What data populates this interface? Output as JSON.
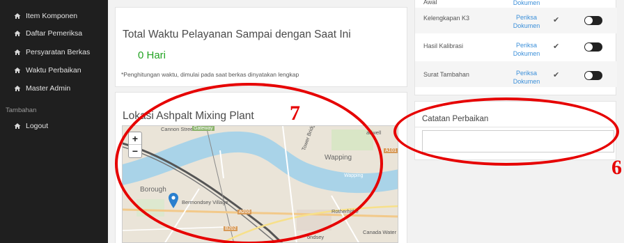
{
  "sidebar": {
    "items": [
      {
        "label": "Item Komponen",
        "icon": "home-icon"
      },
      {
        "label": "Daftar Pemeriksa",
        "icon": "home-icon"
      },
      {
        "label": "Persyaratan Berkas",
        "icon": "home-icon"
      },
      {
        "label": "Waktu Perbaikan",
        "icon": "home-icon"
      },
      {
        "label": "Master Admin",
        "icon": "home-icon"
      }
    ],
    "section_label": "Tambahan",
    "logout_label": "Logout"
  },
  "total_time": {
    "title": "Total Waktu Pelayanan Sampai dengan Saat Ini",
    "value": "0 Hari",
    "note": "*Penghitungan waktu, dimulai pada saat berkas dinyatakan lengkap"
  },
  "map_card": {
    "title": "Lokasi Ashpalt Mixing Plant",
    "zoom_in": "+",
    "zoom_out": "−",
    "labels": {
      "cannon_street": "Cannon Street",
      "gateway": "Gateway",
      "tower_bridge": "Tower Bridge",
      "wapping": "Wapping",
      "wapping_road": "Wapping",
      "borough": "Borough",
      "bermondsey_village": "Bermondsey Village",
      "a200": "A200",
      "a101": "A101",
      "rotherhithe": "Rotherhithe",
      "b202": "B202",
      "canada_water": "Canada Water",
      "wadwell": "adwell",
      "ondsey": "ondsey"
    }
  },
  "documents": {
    "top_partial": {
      "name": "Awal",
      "link": "Dokumen"
    },
    "rows": [
      {
        "name": "Kelengkapan K3",
        "link1": "Periksa",
        "link2": "Dokumen",
        "check": "✔"
      },
      {
        "name": "Hasil Kalibrasi",
        "link1": "Periksa",
        "link2": "Dokumen",
        "check": "✔"
      },
      {
        "name": "Surat Tambahan",
        "link1": "Periksa",
        "link2": "Dokumen",
        "check": "✔"
      }
    ]
  },
  "notes": {
    "title": "Catatan Perbaikan",
    "placeholder": ""
  },
  "annotations": {
    "num_map": "7",
    "num_notes": "6",
    "color": "#e60000"
  }
}
